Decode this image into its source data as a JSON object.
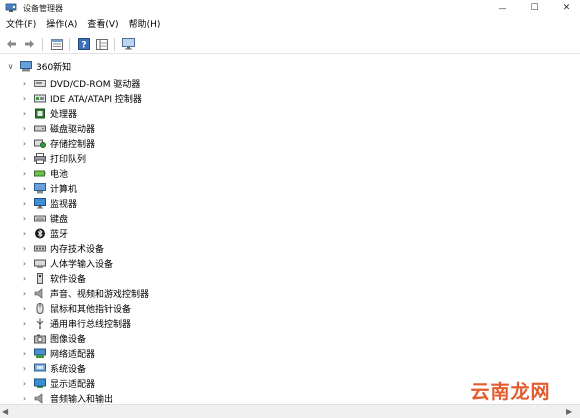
{
  "window": {
    "title": "设备管理器"
  },
  "window_controls": {
    "minimize": "—",
    "maximize": "☐",
    "close": "✕"
  },
  "menu": [
    "文件(F)",
    "操作(A)",
    "查看(V)",
    "帮助(H)"
  ],
  "toolbar_icons": [
    "back-arrow-icon",
    "forward-arrow-icon",
    "properties-pane-icon",
    "help-icon",
    "list-view-icon",
    "monitor-icon"
  ],
  "tree": {
    "root": {
      "label": "360新知",
      "expander": "∨"
    },
    "collapsed_glyph": "›",
    "categories": [
      {
        "label": "DVD/CD-ROM 驱动器",
        "icon": "optical-drive-icon"
      },
      {
        "label": "IDE ATA/ATAPI 控制器",
        "icon": "ide-controller-icon"
      },
      {
        "label": "处理器",
        "icon": "processor-icon"
      },
      {
        "label": "磁盘驱动器",
        "icon": "disk-drive-icon"
      },
      {
        "label": "存储控制器",
        "icon": "storage-controller-icon"
      },
      {
        "label": "打印队列",
        "icon": "printer-icon"
      },
      {
        "label": "电池",
        "icon": "battery-icon"
      },
      {
        "label": "计算机",
        "icon": "computer-icon"
      },
      {
        "label": "监视器",
        "icon": "monitor-icon"
      },
      {
        "label": "键盘",
        "icon": "keyboard-icon"
      },
      {
        "label": "蓝牙",
        "icon": "bluetooth-icon"
      },
      {
        "label": "内存技术设备",
        "icon": "memory-device-icon"
      },
      {
        "label": "人体学输入设备",
        "icon": "hid-icon"
      },
      {
        "label": "软件设备",
        "icon": "software-device-icon"
      },
      {
        "label": "声音、视频和游戏控制器",
        "icon": "speaker-icon"
      },
      {
        "label": "鼠标和其他指针设备",
        "icon": "mouse-icon"
      },
      {
        "label": "通用串行总线控制器",
        "icon": "usb-icon"
      },
      {
        "label": "图像设备",
        "icon": "camera-icon"
      },
      {
        "label": "网络适配器",
        "icon": "network-adapter-icon"
      },
      {
        "label": "系统设备",
        "icon": "system-device-icon"
      },
      {
        "label": "显示适配器",
        "icon": "display-adapter-icon"
      },
      {
        "label": "音频输入和输出",
        "icon": "audio-io-icon"
      }
    ]
  },
  "watermark": {
    "text": "云南龙网"
  },
  "scrollbar": {
    "left": "◀",
    "right": "▶"
  }
}
